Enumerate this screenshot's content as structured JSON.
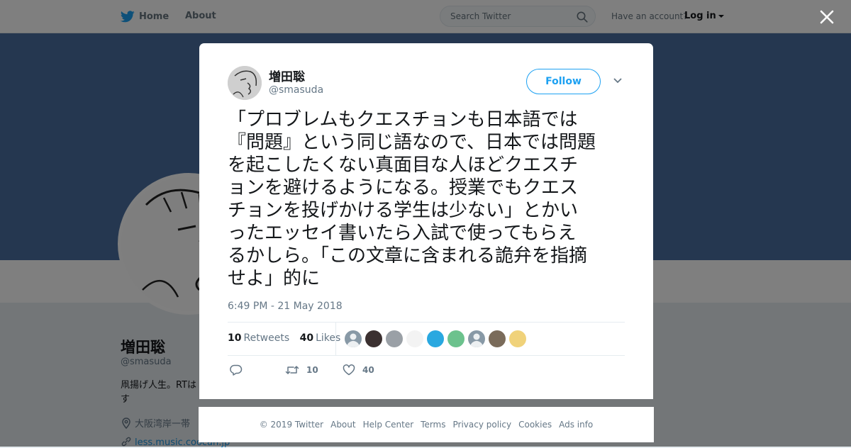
{
  "nav": {
    "home_label": "Home",
    "about_label": "About",
    "search_placeholder": "Search Twitter",
    "account_prompt": "Have an account?",
    "login_label": "Log in"
  },
  "profile": {
    "name": "増田聡",
    "handle": "@smasuda",
    "bio": "凧揚げ人生。RTは",
    "bio_cont": "す",
    "location": "大阪湾岸一帯",
    "url": "less.music.coocan.jp"
  },
  "tweet": {
    "author_name": "増田聡",
    "author_handle": "@smasuda",
    "follow_label": "Follow",
    "lines": [
      "「プロブレムもクエスチョンも日本語では",
      "『問題』という同じ語なので、日本では問題",
      "を起こしたくない真面目な人ほどクエスチ",
      "ョンを避けるようになる。授業でもクエス",
      "チョンを投げかける学生は少ない」とかい",
      "ったエッセイ書いたら入試で使ってもらえ",
      "るかしら。「この文章に含まれる詭弁を指摘",
      "せよ」的に"
    ],
    "timestamp": "6:49 PM - 21 May 2018",
    "retweets_count": "10",
    "retweets_label": "Retweets",
    "likes_count": "40",
    "likes_label": "Likes",
    "retweet_action_count": "10",
    "like_action_count": "40",
    "likers": [
      {
        "icon": "default-avatar",
        "color": "#8899a6"
      },
      {
        "icon": "photo-avatar",
        "color": "#3b3030"
      },
      {
        "icon": "globe-avatar",
        "color": "#9aa0a6"
      },
      {
        "icon": "sketch-avatar",
        "color": "#f3f3f3"
      },
      {
        "icon": "photo-avatar",
        "color": "#29a8e0"
      },
      {
        "icon": "anime-avatar",
        "color": "#6cc28d"
      },
      {
        "icon": "default-avatar",
        "color": "#8899a6"
      },
      {
        "icon": "photo-avatar",
        "color": "#7a6b5a"
      },
      {
        "icon": "anime-avatar",
        "color": "#f0d27a"
      }
    ]
  },
  "footer": {
    "links": [
      "© 2019 Twitter",
      "About",
      "Help Center",
      "Terms",
      "Privacy policy",
      "Cookies",
      "Ads info"
    ]
  },
  "colors": {
    "accent": "#1da1f2",
    "link": "#1b95e0",
    "banner": "#4a6fa0"
  }
}
